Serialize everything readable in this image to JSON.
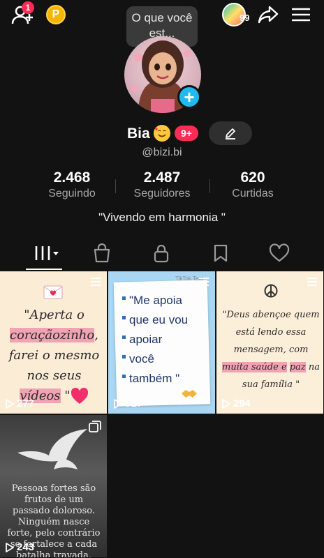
{
  "topbar": {
    "friend_badge": "1",
    "coin_label": "P",
    "tooltip": "O que você est...",
    "story_count": "99"
  },
  "profile": {
    "name": "Bia",
    "notif_badge": "9+",
    "handle": "@bizi.bi",
    "bio": "\"Vivendo em harmonia \""
  },
  "stats": [
    {
      "value": "2.468",
      "label": "Seguindo"
    },
    {
      "value": "2.487",
      "label": "Seguidores"
    },
    {
      "value": "620",
      "label": "Curtidas"
    }
  ],
  "tabs": [
    "videos-tab",
    "shop-tab",
    "private-tab",
    "saved-tab",
    "liked-tab"
  ],
  "videos": [
    {
      "views": "277",
      "parts": [
        "\"Aperta o ",
        "coraçãozinho",
        ", farei o mesmo nos seus ",
        "vídeos",
        " \""
      ]
    },
    {
      "views": "317",
      "lines": [
        "\"Me apoia",
        "que eu vou",
        "apoiar",
        "você",
        "também \""
      ],
      "watermark": "TikTok Text"
    },
    {
      "views": "294",
      "parts": [
        "\"Deus abençoe quem está lendo essa mensagem, com ",
        "muita saúde e",
        " ",
        "paz",
        " na sua família \""
      ]
    },
    {
      "views": "243",
      "text": "Pessoas fortes são frutos de um passado doloroso. Ninguém nasce forte, pelo contrário se fortalece a cada batalha travada."
    }
  ],
  "colors": {
    "accent": "#fe2c55",
    "plus": "#20b9f0",
    "coin": "#f7b500"
  }
}
